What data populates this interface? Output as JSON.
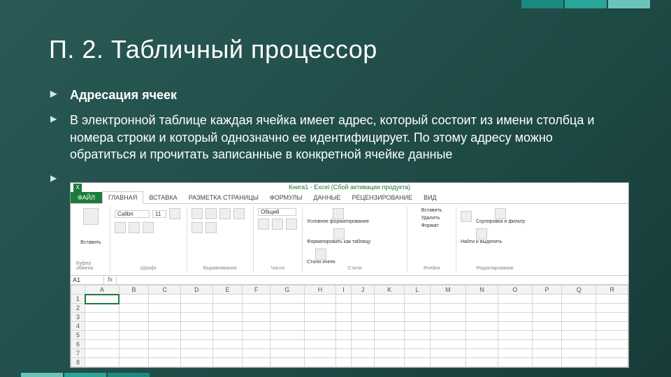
{
  "slide": {
    "title": "П. 2. Табличный процессор",
    "bullet1": "Адресация ячеек",
    "bullet2": "В электронной таблице каждая ячейка имеет адрес, который состоит из имени столбца и номера строки и который однозначно ее идентифицирует. По этому адресу можно обратиться и прочитать записанные в конкретной ячейке данные"
  },
  "excel": {
    "title_bar": "Книга1 - Excel (Сбой активации продукта)",
    "logo_letter": "X",
    "tabs": {
      "file": "ФАЙЛ",
      "items": [
        "ГЛАВНАЯ",
        "ВСТАВКА",
        "РАЗМЕТКА СТРАНИЦЫ",
        "ФОРМУЛЫ",
        "ДАННЫЕ",
        "РЕЦЕНЗИРОВАНИЕ",
        "ВИД"
      ]
    },
    "ribbon": {
      "clipboard": {
        "label": "Буфер обмена",
        "paste": "Вставить"
      },
      "font": {
        "label": "Шрифт",
        "name": "Calibri",
        "size": "11"
      },
      "align": {
        "label": "Выравнивание"
      },
      "number": {
        "label": "Число",
        "format": "Общий"
      },
      "styles": {
        "label": "Стили",
        "cond": "Условное форматирование",
        "fmt": "Форматировать как таблицу",
        "cell": "Стили ячеек"
      },
      "cells": {
        "label": "Ячейки",
        "ins": "Вставить",
        "del": "Удалить",
        "fmt": "Формат"
      },
      "edit": {
        "label": "Редактирование",
        "sort": "Сортировка и фильтр",
        "find": "Найти и выделить"
      }
    },
    "name_box": "A1",
    "fx": "fx",
    "columns": [
      "A",
      "B",
      "C",
      "D",
      "E",
      "F",
      "G",
      "H",
      "I",
      "J",
      "K",
      "L",
      "M",
      "N",
      "O",
      "P",
      "Q",
      "R"
    ],
    "rows": [
      "1",
      "2",
      "3",
      "4",
      "5",
      "6",
      "7",
      "8"
    ]
  },
  "accents": [
    "#1b8a7f",
    "#2aa598",
    "#6bc4ba"
  ]
}
